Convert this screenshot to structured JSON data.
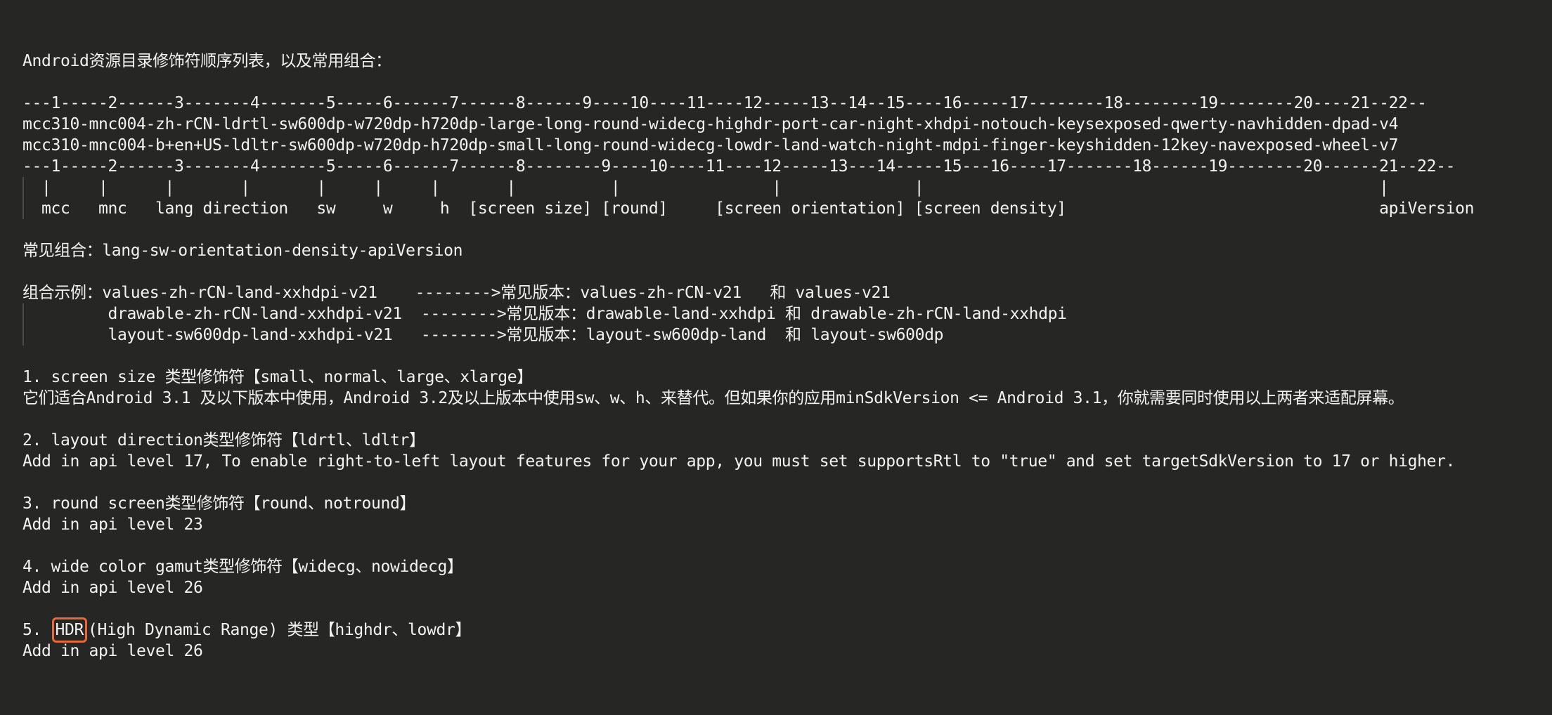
{
  "title": "Android资源目录修饰符顺序列表，以及常用组合：",
  "table": {
    "index_top": "---1-----2------3-------4-------5-----6------7------8------9----10----11----12-----13--14--15----16-----17--------18--------19--------20----21--22--",
    "example_1": "mcc310-mnc004-zh-rCN-ldrtl-sw600dp-w720dp-h720dp-large-long-round-widecg-highdr-port-car-night-xhdpi-notouch-keysexposed-qwerty-navhidden-dpad-v4",
    "example_2": "mcc310-mnc004-b+en+US-ldltr-sw600dp-w720dp-h720dp-small-long-round-widecg-lowdr-land-watch-night-mdpi-finger-keyshidden-12key-navexposed-wheel-v7",
    "index_bottom": "---1-----2------3-------4-------5-----6------7------8--------9----10----11----12-----13---14-----15---16----17-------18------19--------20------21--22--",
    "pipes": "  |     |      |       |       |     |     |       |          |                |              |                                                |",
    "labels": "  mcc   mnc   lang direction   sw     w     h  [screen size] [round]     [screen orientation] [screen density]                                 apiVersion"
  },
  "common": {
    "line": "常见组合：lang-sw-orientation-density-apiVersion"
  },
  "examples": {
    "line1": "组合示例：values-zh-rCN-land-xxhdpi-v21    -------->常见版本：values-zh-rCN-v21   和 values-v21",
    "line2": "         drawable-zh-rCN-land-xxhdpi-v21  -------->常见版本：drawable-land-xxhdpi 和 drawable-zh-rCN-land-xxhdpi",
    "line3": "         layout-sw600dp-land-xxhdpi-v21   -------->常见版本：layout-sw600dp-land  和 layout-sw600dp"
  },
  "sections": {
    "s1_title": "1. screen size 类型修饰符【small、normal、large、xlarge】",
    "s1_body": "它们适合Android 3.1 及以下版本中使用，Android 3.2及以上版本中使用sw、w、h、来替代。但如果你的应用minSdkVersion <= Android 3.1，你就需要同时使用以上两者来适配屏幕。",
    "s2_title": "2. layout direction类型修饰符【ldrtl、ldltr】",
    "s2_body": "Add in api level 17, To enable right-to-left layout features for your app, you must set supportsRtl to \"true\" and set targetSdkVersion to 17 or higher.",
    "s3_title": "3. round screen类型修饰符【round、notround】",
    "s3_body": "Add in api level 23",
    "s4_title": "4. wide color gamut类型修饰符【widecg、nowidecg】",
    "s4_body": "Add in api level 26",
    "s5_prefix": "5. ",
    "s5_highlight": "HDR",
    "s5_rest": "(High Dynamic Range) 类型【highdr、lowdr】",
    "s5_body": "Add in api level 26"
  },
  "colors": {
    "background": "#262624",
    "text": "#f2f2f2",
    "highlight_border": "#e8673c"
  }
}
